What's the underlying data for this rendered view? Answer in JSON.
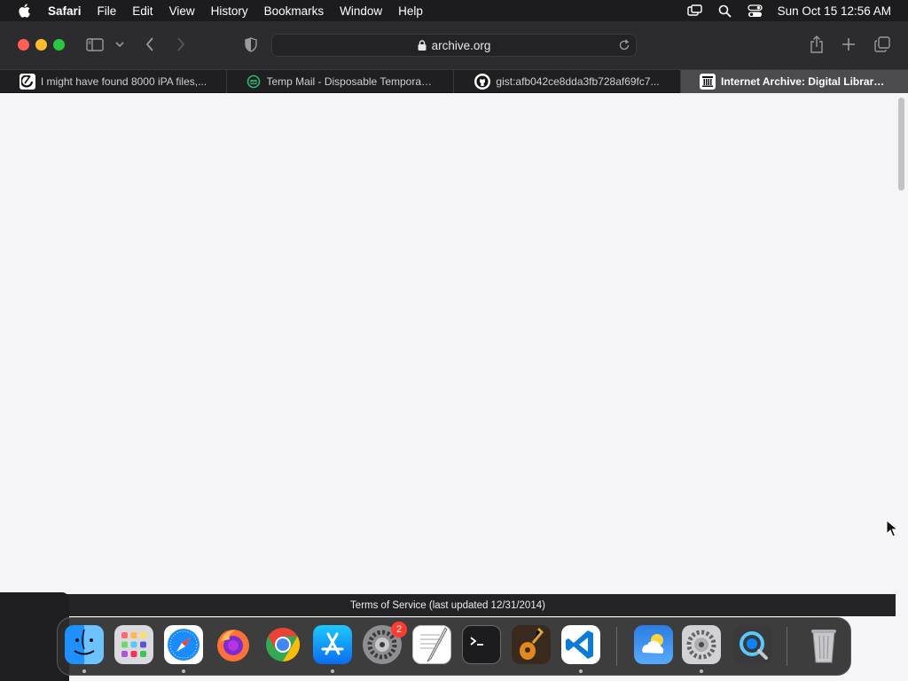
{
  "menubar": {
    "app_name": "Safari",
    "items": [
      "File",
      "Edit",
      "View",
      "History",
      "Bookmarks",
      "Window",
      "Help"
    ],
    "clock": "Sun Oct 15  12:56 AM"
  },
  "toolbar": {
    "url": "archive.org"
  },
  "tabs": [
    {
      "label": "I might have found 8000 iPA files,...",
      "favicon": "reddit-icon"
    },
    {
      "label": "Temp Mail - Disposable Temporary...",
      "favicon": "tempmail-icon"
    },
    {
      "label": "gist:afb042ce8dda3fb728af69fc7...",
      "favicon": "github-icon"
    },
    {
      "label": "Internet Archive: Digital Library of...",
      "favicon": "archive-icon"
    }
  ],
  "footer": {
    "text": "Terms of Service (last updated 12/31/2014)"
  },
  "dock": {
    "settings_badge": "2",
    "apps": [
      "Finder",
      "Launchpad",
      "Safari",
      "Firefox",
      "Chrome",
      "App Store",
      "System Settings",
      "TextEdit",
      "Terminal",
      "GarageBand",
      "VS Code",
      "Weather",
      "System Preferences",
      "Proxyman",
      "Trash"
    ]
  },
  "colors": {
    "close": "#ff5f57",
    "minimize": "#febc2e",
    "maximize": "#28c840",
    "active_tab": "#4b4b4f",
    "badge": "#ff3b30"
  }
}
